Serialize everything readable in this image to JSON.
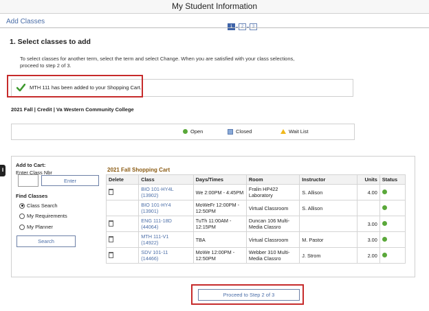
{
  "header": {
    "title": "My Student Information"
  },
  "subheader": {
    "title": "Add Classes",
    "steps": [
      "1",
      "2",
      "3"
    ],
    "active_step": 1
  },
  "section": {
    "heading": "1.  Select classes to add",
    "instructions": "To select classes for another term, select the term and select Change.  When you are satisfied with your class selections, proceed to step 2 of 3."
  },
  "message": {
    "text": "MTH  111 has been added to your Shopping Cart.",
    "icon": "checkmark-icon"
  },
  "term": {
    "label": "2021 Fall | Credit | Va Western Community College"
  },
  "legend": {
    "open": "Open",
    "closed": "Closed",
    "waitlist": "Wait List",
    "colors": {
      "open": "#5aa83a",
      "closed": "#8aaad8",
      "waitlist": "#f0b81c"
    }
  },
  "add_to_cart": {
    "title": "Add to Cart:",
    "class_nbr_label": "Enter Class Nbr",
    "class_nbr_value": "",
    "enter_button": "Enter",
    "find_classes_label": "Find Classes",
    "options": [
      "Class Search",
      "My Requirements",
      "My Planner"
    ],
    "selected_option": "Class Search",
    "search_button": "Search"
  },
  "cart": {
    "title": "2021 Fall Shopping Cart",
    "columns": [
      "Delete",
      "Class",
      "Days/Times",
      "Room",
      "Instructor",
      "Units",
      "Status"
    ],
    "rows": [
      {
        "deletable": true,
        "class_code": "BIO 101-HY4L",
        "class_nbr": "(13902)",
        "days_times": "We 2:00PM - 4:45PM",
        "room": "Fralin HP422 Laboratory",
        "instructor": "S. Allison",
        "units": "4.00",
        "status": "Open"
      },
      {
        "deletable": false,
        "class_code": "BIO 101-HY4",
        "class_nbr": "(13901)",
        "days_times": "MoWeFr 12:00PM - 12:50PM",
        "room": "Virtual Classroom",
        "instructor": "S. Allison",
        "units": "",
        "status": "Open"
      },
      {
        "deletable": true,
        "class_code": "ENG 111-18D",
        "class_nbr": "(44064)",
        "days_times": "TuTh 11:00AM - 12:15PM",
        "room": "Duncan 106 Multi-Media Classro",
        "instructor": "",
        "units": "3.00",
        "status": "Open"
      },
      {
        "deletable": true,
        "class_code": "MTH 111-V1",
        "class_nbr": "(14922)",
        "days_times": "TBA",
        "room": "Virtual Classroom",
        "instructor": "M. Pastor",
        "units": "3.00",
        "status": "Open"
      },
      {
        "deletable": true,
        "class_code": "SDV 101-11",
        "class_nbr": "(14466)",
        "days_times": "MoWe 12:00PM - 12:50PM",
        "room": "Webber 310 Multi-Media Classro",
        "instructor": "J. Strom",
        "units": "2.00",
        "status": "Open"
      }
    ]
  },
  "proceed_button": "Proceed to Step 2 of 3"
}
